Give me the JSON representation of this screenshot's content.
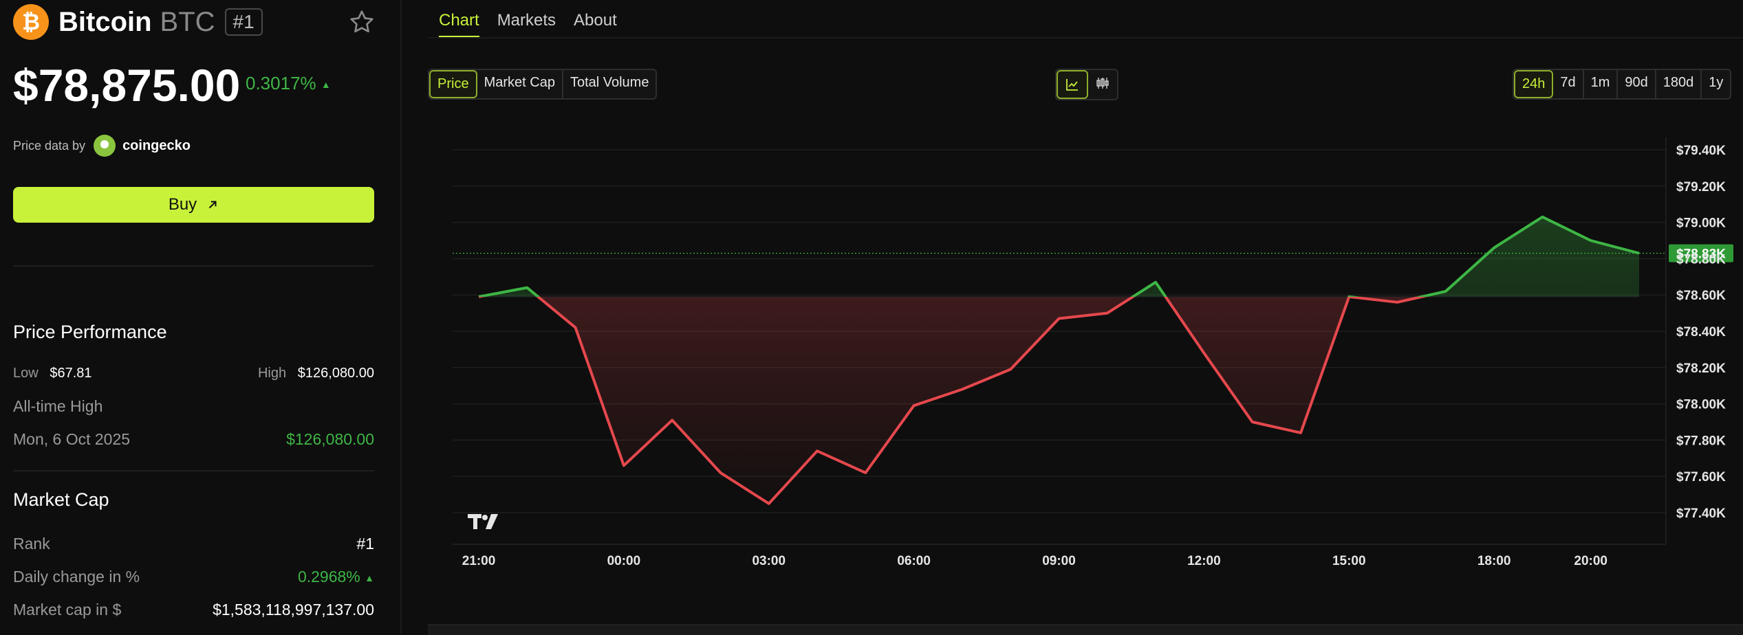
{
  "coin": {
    "logo_glyph": "₿",
    "name": "Bitcoin",
    "symbol": "BTC",
    "rank_badge": "#1",
    "price": "$78,875.00",
    "change": "0.3017%",
    "change_arrow": "▲"
  },
  "source": {
    "label": "Price data by",
    "name": "coingecko"
  },
  "buy": {
    "label": "Buy"
  },
  "performance": {
    "title": "Price Performance",
    "low_label": "Low",
    "low_value": "$67.81",
    "high_label": "High",
    "high_value": "$126,080.00",
    "ath_label": "All-time High",
    "ath_date": "Mon, 6 Oct 2025",
    "ath_value": "$126,080.00"
  },
  "market_cap": {
    "title": "Market Cap",
    "rank_label": "Rank",
    "rank_value": "#1",
    "daily_label": "Daily change in %",
    "daily_value": "0.2968%",
    "daily_arrow": "▲",
    "cap_label": "Market cap in $",
    "cap_value": "$1,583,118,997,137.00"
  },
  "tabs": [
    "Chart",
    "Markets",
    "About"
  ],
  "metric_buttons": [
    "Price",
    "Market Cap",
    "Total Volume"
  ],
  "chart_type_icons": [
    "line-chart-icon",
    "candlestick-icon"
  ],
  "ranges": [
    "24h",
    "7d",
    "1m",
    "90d",
    "180d",
    "1y"
  ],
  "colors": {
    "accent": "#c8f23a",
    "up": "#3eb645",
    "down": "#e5484d",
    "btc": "#f7931a"
  },
  "chart_data": {
    "type": "line",
    "x": [
      "21:00",
      "22:00",
      "23:00",
      "00:00",
      "01:00",
      "02:00",
      "03:00",
      "04:00",
      "05:00",
      "06:00",
      "07:00",
      "08:00",
      "09:00",
      "10:00",
      "11:00",
      "12:00",
      "13:00",
      "14:00",
      "15:00",
      "16:00",
      "17:00",
      "18:00",
      "19:00",
      "20:00",
      "21:00"
    ],
    "values": [
      78590,
      78640,
      78420,
      77660,
      77910,
      77620,
      77450,
      77740,
      77620,
      77990,
      78080,
      78190,
      78470,
      78500,
      78670,
      78280,
      77900,
      77840,
      78590,
      78560,
      78620,
      78860,
      79030,
      78900,
      78830
    ],
    "baseline": 78590,
    "current_label": "$78.83K",
    "x_ticks": [
      "21:00",
      "00:00",
      "03:00",
      "06:00",
      "09:00",
      "12:00",
      "15:00",
      "18:00",
      "20:00"
    ],
    "y_ticks": [
      "$79.40K",
      "$79.20K",
      "$79.00K",
      "$78.80K",
      "$78.60K",
      "$78.40K",
      "$78.20K",
      "$78.00K",
      "$77.80K",
      "$77.60K",
      "$77.40K"
    ],
    "y_tick_values": [
      79400,
      79200,
      79000,
      78800,
      78600,
      78400,
      78200,
      78000,
      77800,
      77600,
      77400
    ],
    "ylim": [
      77400,
      79400
    ],
    "grid": true,
    "watermark": "TV"
  }
}
